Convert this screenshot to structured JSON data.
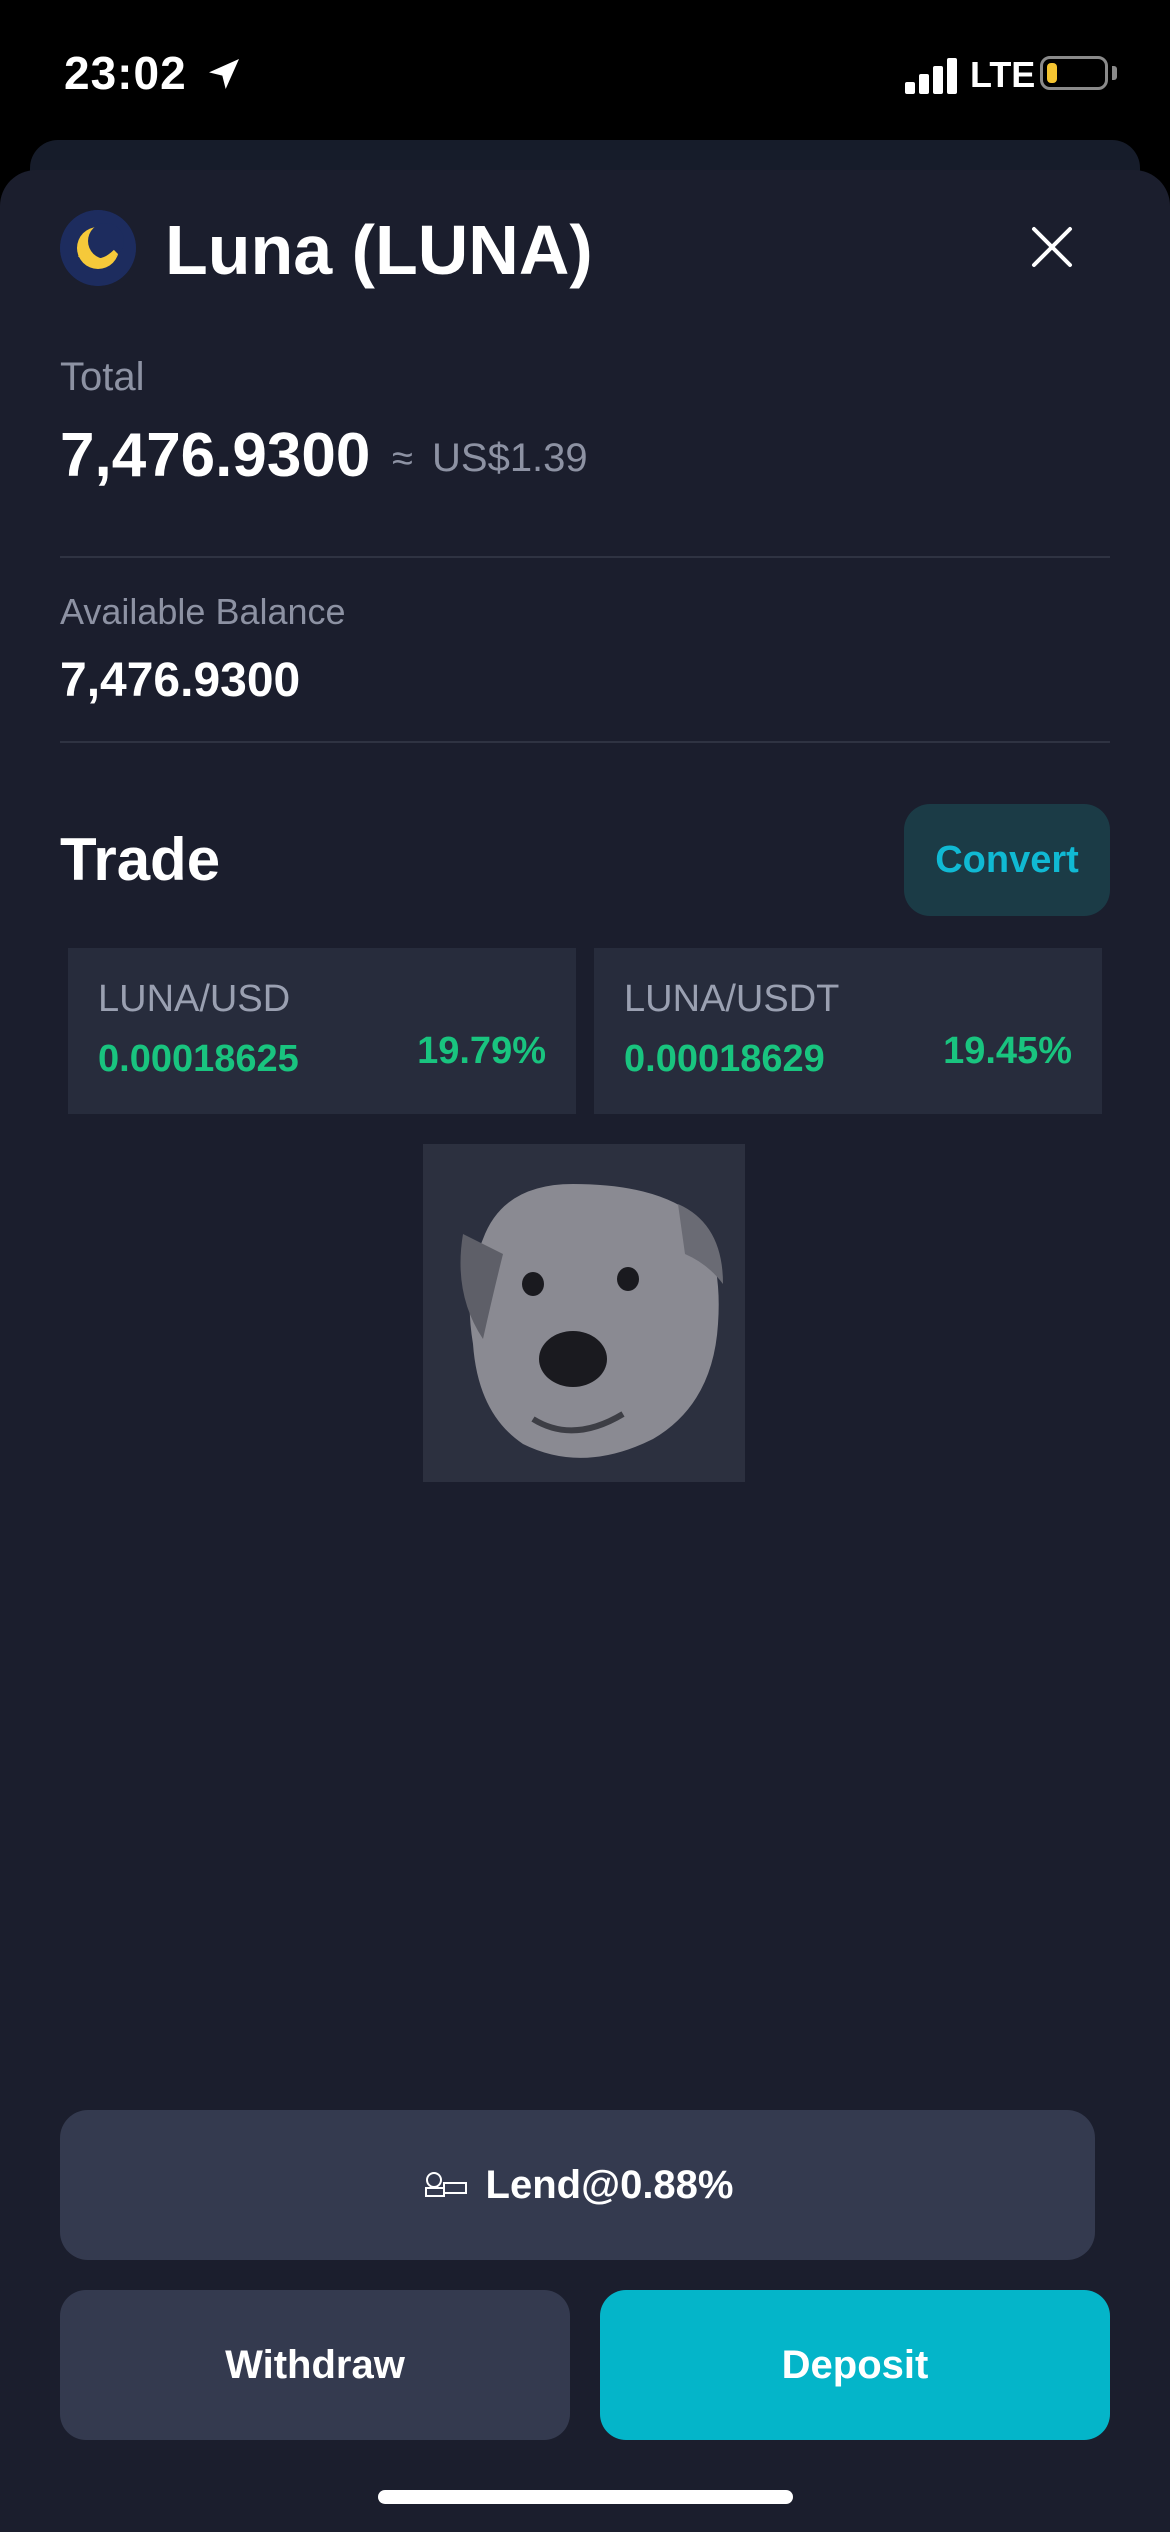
{
  "status_bar": {
    "time": "23:02",
    "network": "LTE",
    "battery_color": "#f4c431"
  },
  "header": {
    "title": "Luna (LUNA)",
    "close_icon": "close-icon",
    "coin_icon": "luna-coin-icon"
  },
  "total": {
    "label": "Total",
    "value": "7,476.9300",
    "approx_symbol": "≈",
    "fiat_value": "US$1.39"
  },
  "available": {
    "label": "Available Balance",
    "value": "7,476.9300"
  },
  "trade": {
    "title": "Trade",
    "convert_label": "Convert",
    "markets": [
      {
        "pair": "LUNA/USD",
        "price": "0.00018625",
        "change": "19.79%"
      },
      {
        "pair": "LUNA/USDT",
        "price": "0.00018629",
        "change": "19.45%"
      }
    ]
  },
  "actions": {
    "lend_label": "Lend@0.88%",
    "withdraw_label": "Withdraw",
    "deposit_label": "Deposit"
  },
  "colors": {
    "background": "#1b1e2d",
    "accent": "#04b5c9",
    "positive": "#19c47f",
    "muted": "#8d92a3"
  }
}
